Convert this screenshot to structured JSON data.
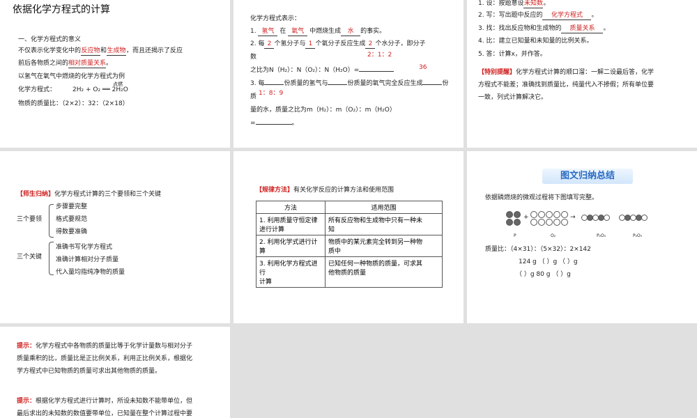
{
  "s1": {
    "title": "依据化学方程式的计算",
    "l1": "一、化学方程式的意义",
    "l2a": "不仅表示化学变化中的",
    "l2ans1": "反应物",
    "l2b": "和",
    "l2ans2": "生成物",
    "l2c": "，而且还揭示了反应",
    "l3a": "前后各物质之间的",
    "l3ans": "相对质量关系",
    "l3b": "。",
    "l4": "以氢气在氧气中燃烧的化学方程式为例",
    "l5a": "化学方程式：",
    "l5eq": "2H₂   +   O₂ ══ 2H₂O",
    "l5cond": "点燃",
    "l6": "物质的质量比：（2×2）：32：（2×18）"
  },
  "s2": {
    "l1": "化学方程式表示：",
    "l2a": "1.",
    "l2ans1": "氢气",
    "l2b": "在",
    "l2ans2": "氧气",
    "l2c": "中燃烧生成",
    "l2ans3": "水",
    "l2d": "的事实。",
    "l3a": "2. 每",
    "l3ans1": "2",
    "l3b": "个氢分子与",
    "l3ans2": "1",
    "l3c": "个氧分子反应生成",
    "l3ans3": "2",
    "l3d": "个水分子，即分子",
    "l3ratio": "2：1：2",
    "l4": "数",
    "l5a": "之比为N（H₂）：N（O₂）：N（H₂O）=",
    "l5ans": "36",
    "l6a": "3. 每",
    "l6b": "份质量的氢气与",
    "l6c": "份质量的氧气完全反应生成",
    "l6d": "份",
    "l7": "质",
    "l7ans": "1：8：9",
    "l8": "量的水，质量之比为m（H₂）：m（O₂）：m（H₂O）",
    "l9": "=",
    "l9b": "。"
  },
  "s3": {
    "l1a": "1. 设：按题意设",
    "l1ans": "未知数",
    "l1b": "。",
    "l2a": "2. 写：写出题中反应的",
    "l2ans": "化学方程式",
    "l2b": "。",
    "l3a": "3. 找：找出反应物和生成物的",
    "l3ans": "质量关系",
    "l3b": "。",
    "l4": "4. 比：建立已知量和未知量的比例关系。",
    "l5": "5. 答：计算x，并作答。",
    "tip_tag": "【特别提醒】",
    "tip1": "化学方程式计算的顺口溜：一解二设最后答，化学",
    "tip2": "方程式不能差；准确找到质量比，纯量代入不掺假；所有单位要",
    "tip3": "一致，列式计算解决它。"
  },
  "s4": {
    "tag": "【师生归纳】",
    "head": "化学方程式计算的三个要领和三个关键",
    "g1": "三个要领",
    "g1items": [
      "步骤要完整",
      "格式要规范",
      "得数要准确"
    ],
    "g2": "三个关键",
    "g2items": [
      "准确书写化学方程式",
      "准确计算相对分子质量",
      "代入量均指纯净物的质量"
    ]
  },
  "s5": {
    "tag": "【规律方法】",
    "head": "有关化学反应的计算方法和使用范围",
    "col1": "方法",
    "col2": "适用范围",
    "rows": [
      {
        "m1": "1. 利用质量守恒定律",
        "m2": "进行计算",
        "s1": "所有反应物和生成物中只有一种未",
        "s2": "知"
      },
      {
        "m1": "2. 利用化学式进行计",
        "m2": "算",
        "s1": "物质中的某元素完全转到另一种物",
        "s2": "质中"
      },
      {
        "m1": "3. 利用化学方程式进行",
        "m2": "计算",
        "s1": "已知任何一种物质的质量，可求其",
        "s2": "他物质的质量"
      }
    ]
  },
  "s6": {
    "banner": "图文归纳总结",
    "l1": "依据磷燃烧的微观过程将下图填写完整。",
    "lab_p": "P",
    "lab_o2": "O₂",
    "lab_p2o5a": "P₂O₅",
    "lab_p2o5b": "P₂O₅",
    "mass": "质量比：（4×31）：（5×32）：2×142",
    "r1": "124 g      （      ）g      （      ）g",
    "r2": "（      ）g      80 g      （      ）g"
  },
  "s7": {
    "hint1_tag": "提示：",
    "hint1a": "化学方程式中各物质的质量比等于化学计量数与相对分子",
    "hint1b": "质量乘积的比，质量比是正比例关系，利用正比例关系，根据化",
    "hint1c": "学方程式中已知物质的质量可求出其他物质的质量。",
    "hint2_tag": "提示：",
    "hint2a": "根据化学方程式进行计算时，所设未知数不能带单位，但",
    "hint2b": "最后求出的未知数的数值要带单位，已知量在整个计算过程中要"
  }
}
